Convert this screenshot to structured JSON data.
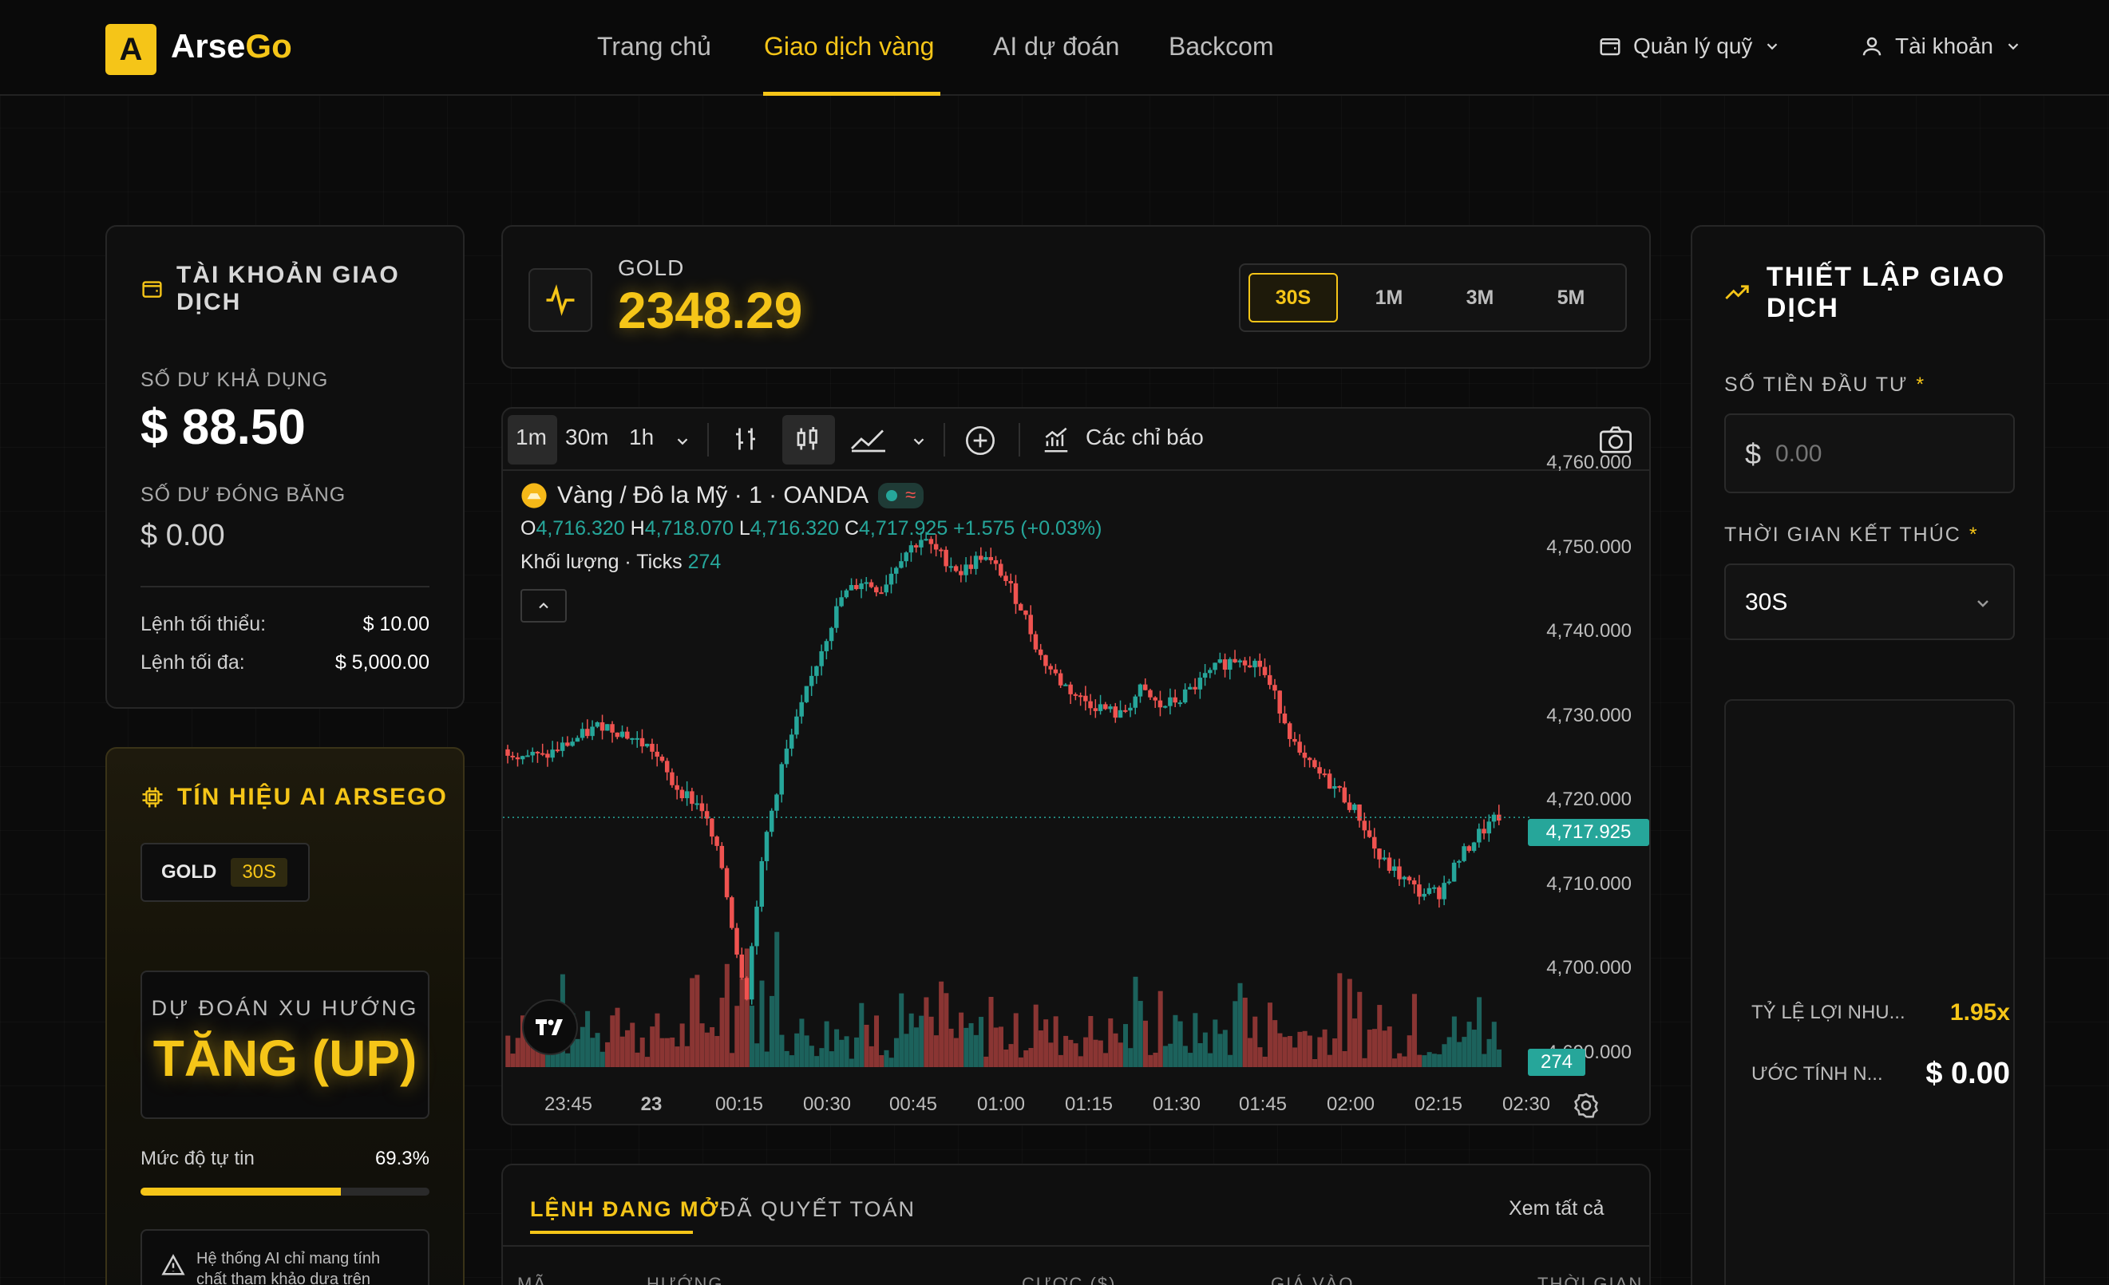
{
  "brand": {
    "letter": "A",
    "name": "Arse",
    "name_accent": "Go"
  },
  "nav": {
    "links": [
      "Trang chủ",
      "Giao dịch vàng",
      "AI dự đoán",
      "Backcom"
    ],
    "fund": "Quản lý quỹ",
    "account": "Tài khoản"
  },
  "account": {
    "title": "TÀI KHOẢN GIAO DỊCH",
    "available_label": "SỐ DƯ KHẢ DỤNG",
    "available_value": "$ 88.50",
    "frozen_label": "SỐ DƯ ĐÓNG BĂNG",
    "frozen_value": "$ 0.00",
    "min_label": "Lệnh tối thiểu:",
    "min_value": "$ 10.00",
    "max_label": "Lệnh tối đa:",
    "max_value": "$ 5,000.00"
  },
  "ai": {
    "title": "TÍN HIỆU AI ARSEGO",
    "asset": "GOLD",
    "tf": "30S",
    "trend_label": "DỰ ĐOÁN XU HƯỚNG",
    "trend_value": "TĂNG (UP)",
    "confidence_label": "Mức độ tự tin",
    "confidence_value": "69.3%",
    "confidence": 0.693,
    "warning_line1": "Hệ thống AI chỉ mang tính",
    "warning_line2": "chất tham khảo dựa trên"
  },
  "ticker": {
    "label": "GOLD",
    "price": "2348.29",
    "timeframes": [
      "30S",
      "1M",
      "3M",
      "5M"
    ],
    "active_tf": "30S"
  },
  "chart": {
    "toolbar": {
      "tf1": "1m",
      "tf2": "30m",
      "tf3": "1h",
      "indicators": "Các chỉ báo"
    },
    "symbol": "Vàng / Đô la Mỹ · 1 · OANDA",
    "o_label": "O",
    "o": "4,716.320",
    "h_label": "H",
    "h": "4,718.070",
    "l_label": "L",
    "l": "4,716.320",
    "c_label": "C",
    "c": "4,717.925",
    "change": "+1.575 (+0.03%)",
    "volume_label": "Khối lượng · Ticks",
    "volume": "274",
    "last_price": "4,717.925",
    "volume_tag": "274"
  },
  "chart_data": {
    "type": "candlestick",
    "x_ticks": [
      "23:45",
      "23",
      "00:15",
      "00:30",
      "00:45",
      "01:00",
      "01:15",
      "01:30",
      "01:45",
      "02:00",
      "02:15",
      "02:30"
    ],
    "y_ticks": [
      "4,760.000",
      "4,750.000",
      "4,740.000",
      "4,730.000",
      "4,720.000",
      "4,710.000",
      "4,700.000",
      "4,690.000"
    ],
    "ylim": [
      4688,
      4760
    ],
    "last": 4717.925,
    "close_path": [
      [
        0,
        4726
      ],
      [
        8,
        4725
      ],
      [
        14,
        4727
      ],
      [
        20,
        4729
      ],
      [
        24,
        4728
      ],
      [
        30,
        4726
      ],
      [
        34,
        4722
      ],
      [
        40,
        4719
      ],
      [
        44,
        4712
      ],
      [
        47,
        4702
      ],
      [
        49,
        4697
      ],
      [
        51,
        4708
      ],
      [
        53,
        4716
      ],
      [
        56,
        4724
      ],
      [
        60,
        4731
      ],
      [
        64,
        4738
      ],
      [
        68,
        4744
      ],
      [
        72,
        4746
      ],
      [
        76,
        4745
      ],
      [
        80,
        4749
      ],
      [
        84,
        4751
      ],
      [
        88,
        4749
      ],
      [
        92,
        4747
      ],
      [
        96,
        4749
      ],
      [
        100,
        4747
      ],
      [
        104,
        4743
      ],
      [
        108,
        4737
      ],
      [
        112,
        4734
      ],
      [
        116,
        4732
      ],
      [
        120,
        4731
      ],
      [
        124,
        4730
      ],
      [
        128,
        4733
      ],
      [
        132,
        4731
      ],
      [
        136,
        4732
      ],
      [
        140,
        4734
      ],
      [
        144,
        4736
      ],
      [
        148,
        4737
      ],
      [
        152,
        4736
      ],
      [
        156,
        4731
      ],
      [
        160,
        4725
      ],
      [
        164,
        4723
      ],
      [
        168,
        4721
      ],
      [
        172,
        4718
      ],
      [
        176,
        4713
      ],
      [
        180,
        4711
      ],
      [
        184,
        4709
      ],
      [
        188,
        4709
      ],
      [
        192,
        4713
      ],
      [
        196,
        4716
      ],
      [
        200,
        4718
      ]
    ]
  },
  "orders": {
    "tab_open": "LỆNH ĐANG MỞ",
    "tab_settled": "ĐÃ QUYẾT TOÁN",
    "view_all": "Xem tất cả",
    "columns": [
      "MÃ",
      "HƯỚNG",
      "CƯỢC ($)",
      "GIÁ VÀO",
      "THỜI GIAN"
    ]
  },
  "setup": {
    "title": "THIẾT LẬP GIAO DỊCH",
    "amount_label": "SỐ TIỀN ĐẦU TƯ",
    "amount_prefix": "$",
    "amount_placeholder": "0.00",
    "required": "*",
    "end_label": "THỜI GIAN KẾT THÚC",
    "end_value": "30S",
    "ratio_label": "TỶ LỆ LỢI NHU...",
    "ratio_value": "1.95x",
    "est_label": "ƯỚC TÍNH N...",
    "est_value": "$ 0.00"
  },
  "colors": {
    "accent": "#f5c518",
    "up": "#26a69a",
    "down": "#ef5350"
  }
}
